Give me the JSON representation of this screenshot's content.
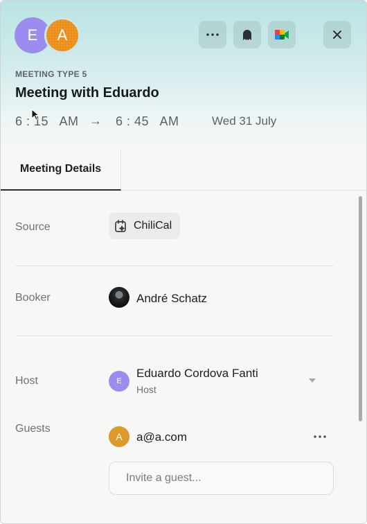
{
  "header": {
    "avatars": [
      {
        "initial": "E",
        "color": "#9d8cf0"
      },
      {
        "initial": "A",
        "color": "#ec8f1a"
      }
    ],
    "buttons": {
      "more_icon": "more-horizontal-icon",
      "ghost_icon": "ghost-icon",
      "meet_icon": "google-meet-icon",
      "close_icon": "close-icon"
    },
    "meeting_type": "MEETING TYPE 5",
    "title": "Meeting with Eduardo",
    "start_time": "6 : 15   AM",
    "arrow": "→",
    "end_time": "6 : 45   AM",
    "date": "Wed 31 July"
  },
  "tabs": [
    {
      "label": "Meeting Details",
      "active": true
    }
  ],
  "details": {
    "source": {
      "label": "Source",
      "value": "ChiliCal",
      "icon": "calendar-sparkle-icon"
    },
    "booker": {
      "label": "Booker",
      "name": "André Schatz"
    },
    "host": {
      "label": "Host",
      "name": "Eduardo Cordova Fanti",
      "role": "Host",
      "initial": "E"
    },
    "guests": {
      "label": "Guests",
      "items": [
        {
          "initial": "A",
          "email": "a@a.com"
        }
      ],
      "invite_placeholder": "Invite a guest..."
    }
  },
  "colors": {
    "accent_purple": "#9d8cf0",
    "accent_orange": "#ec8f1a",
    "header_teal": "#b9e4e3"
  }
}
